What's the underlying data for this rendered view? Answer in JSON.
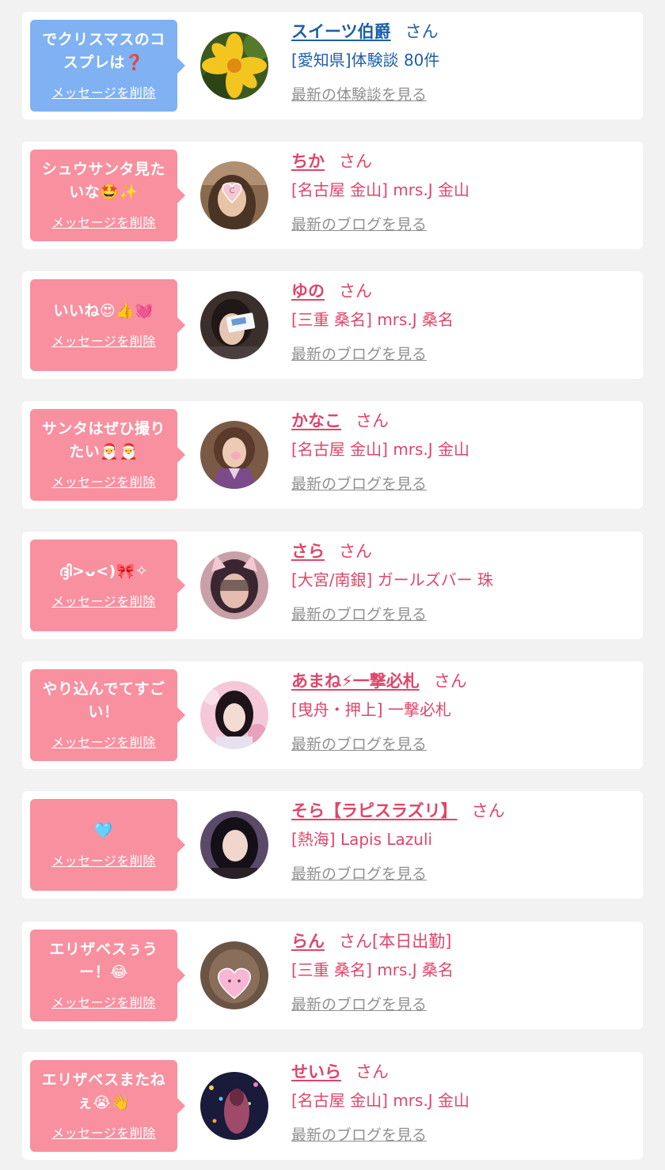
{
  "colors": {
    "pink": "#f8909f",
    "blue": "#7fb1f3",
    "name_pink": "#e0456a",
    "name_blue": "#1d5fa6",
    "link_gray": "#909090"
  },
  "delete_label": "メッセージを削除",
  "items": [
    {
      "message": "でクリスマスのコスプレは❓",
      "name": "スイーツ伯爵",
      "honorific": "さん",
      "shop": "[愛知県]体験談 80件",
      "link": "最新の体験談を見る",
      "theme": "blue",
      "avatar_icon": "yellow-flower-photo"
    },
    {
      "message": "シュウサンタ見たいな🤩✨",
      "name": "ちか",
      "honorific": "さん",
      "shop": "[名古屋 金山] mrs.J 金山",
      "link": "最新のブログを見る",
      "theme": "pink",
      "avatar_icon": "girl-photo-heart-sticker"
    },
    {
      "message": "いいね😍👍💓",
      "name": "ゆの",
      "honorific": "さん",
      "shop": "[三重 桑名] mrs.J 桑名",
      "link": "最新のブログを見る",
      "theme": "pink",
      "avatar_icon": "girl-photo-card"
    },
    {
      "message": "サンタはぜひ撮りたい🎅🎅",
      "name": "かなこ",
      "honorific": "さん",
      "shop": "[名古屋 金山] mrs.J 金山",
      "link": "最新のブログを見る",
      "theme": "pink",
      "avatar_icon": "girl-photo-kimono"
    },
    {
      "message": "ദ്ദി>ᴗ<)🎀✧",
      "name": "さら",
      "honorific": "さん",
      "shop": "[大宮/南銀] ガールズバー 珠",
      "link": "最新のブログを見る",
      "theme": "pink",
      "avatar_icon": "girl-photo-cat-ears"
    },
    {
      "message": "やり込んでてすごい！",
      "name": "あまね⚡一撃必札",
      "honorific": "さん",
      "shop": "[曳舟・押上] 一撃必札",
      "link": "最新のブログを見る",
      "theme": "pink",
      "avatar_icon": "girl-photo-pink"
    },
    {
      "message": "🩵",
      "name": "そら【ラピスラズリ】",
      "honorific": "さん",
      "shop": "[熱海] Lapis Lazuli",
      "link": "最新のブログを見る",
      "theme": "pink",
      "avatar_icon": "girl-photo-dark-hair"
    },
    {
      "message": "エリザベスぅうー！😂",
      "name": "らん",
      "honorific": "さん[本日出勤]",
      "shop": "[三重 桑名] mrs.J 桑名",
      "link": "最新のブログを見る",
      "theme": "pink",
      "avatar_icon": "girl-photo-heart-face"
    },
    {
      "message": "エリザベスまたねぇ😭👋",
      "name": "せいら",
      "honorific": "さん",
      "shop": "[名古屋 金山] mrs.J 金山",
      "link": "最新のブログを見る",
      "theme": "pink",
      "avatar_icon": "girl-photo-night-lights"
    }
  ]
}
